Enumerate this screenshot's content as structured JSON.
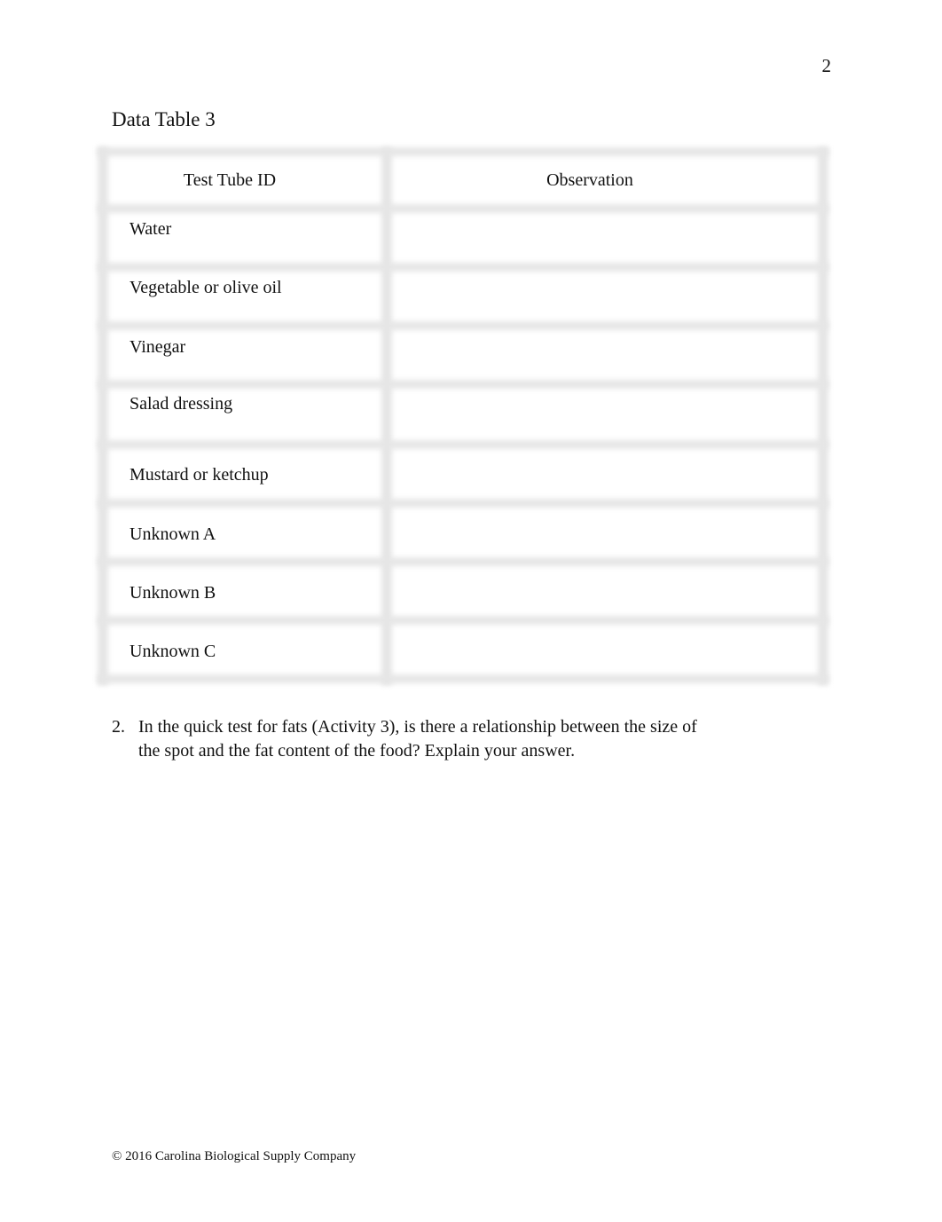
{
  "page": {
    "number": "2"
  },
  "table": {
    "title": "Data Table 3",
    "headers": [
      "Test Tube ID",
      "Observation"
    ],
    "rows": [
      {
        "id": "Water",
        "observation": ""
      },
      {
        "id": "Vegetable or olive oil",
        "observation": ""
      },
      {
        "id": "Vinegar",
        "observation": ""
      },
      {
        "id": "Salad dressing",
        "observation": ""
      },
      {
        "id": "Mustard or ketchup",
        "observation": ""
      },
      {
        "id": "Unknown A",
        "observation": ""
      },
      {
        "id": "Unknown B",
        "observation": ""
      },
      {
        "id": "Unknown C",
        "observation": ""
      }
    ]
  },
  "question": {
    "number": "2.",
    "text": "In the quick test for fats (Activity 3), is there a relationship between the size of the spot and the fat content of the food? Explain your answer."
  },
  "footer": {
    "copyright": "© 2016 Carolina Biological Supply Company"
  }
}
